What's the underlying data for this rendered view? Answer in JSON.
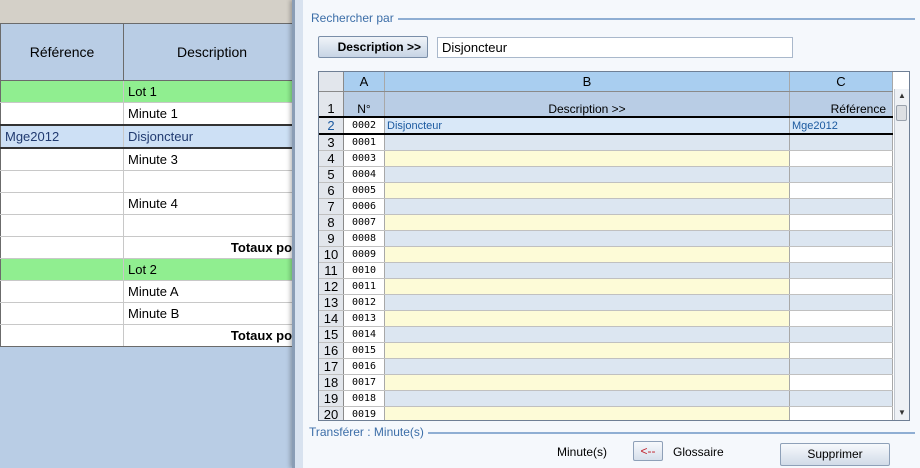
{
  "sheet": {
    "headers": {
      "reference": "Référence",
      "description": "Description"
    },
    "rows": [
      {
        "type": "green",
        "reference": "",
        "description": "Lot 1"
      },
      {
        "type": "normal",
        "reference": "",
        "description": "Minute 1"
      },
      {
        "type": "selected",
        "reference": "Mge2012",
        "description": "Disjoncteur"
      },
      {
        "type": "normal",
        "reference": "",
        "description": "Minute 3"
      },
      {
        "type": "normal",
        "reference": "",
        "description": ""
      },
      {
        "type": "normal",
        "reference": "",
        "description": "Minute 4"
      },
      {
        "type": "normal",
        "reference": "",
        "description": ""
      },
      {
        "type": "total",
        "reference": "",
        "description": "Totaux pou"
      },
      {
        "type": "green",
        "reference": "",
        "description": "Lot 2"
      },
      {
        "type": "normal",
        "reference": "",
        "description": "Minute A"
      },
      {
        "type": "normal",
        "reference": "",
        "description": "Minute B"
      },
      {
        "type": "total",
        "reference": "",
        "description": "Totaux pou"
      }
    ]
  },
  "dialog": {
    "search_group_label": "Rechercher par",
    "search_by_button": "Description >>",
    "search_value": "Disjoncteur",
    "grid": {
      "col_letters": [
        "A",
        "B",
        "C"
      ],
      "field_headers": [
        "N°",
        "Description >>",
        "Référence"
      ],
      "header_row_number": "1",
      "rows": [
        {
          "num": "2",
          "no": "0002",
          "description": "Disjoncteur",
          "reference": "Mge2012"
        },
        {
          "num": "3",
          "no": "0001",
          "description": "",
          "reference": ""
        },
        {
          "num": "4",
          "no": "0003",
          "description": "",
          "reference": ""
        },
        {
          "num": "5",
          "no": "0004",
          "description": "",
          "reference": ""
        },
        {
          "num": "6",
          "no": "0005",
          "description": "",
          "reference": ""
        },
        {
          "num": "7",
          "no": "0006",
          "description": "",
          "reference": ""
        },
        {
          "num": "8",
          "no": "0007",
          "description": "",
          "reference": ""
        },
        {
          "num": "9",
          "no": "0008",
          "description": "",
          "reference": ""
        },
        {
          "num": "10",
          "no": "0009",
          "description": "",
          "reference": ""
        },
        {
          "num": "11",
          "no": "0010",
          "description": "",
          "reference": ""
        },
        {
          "num": "12",
          "no": "0011",
          "description": "",
          "reference": ""
        },
        {
          "num": "13",
          "no": "0012",
          "description": "",
          "reference": ""
        },
        {
          "num": "14",
          "no": "0013",
          "description": "",
          "reference": ""
        },
        {
          "num": "15",
          "no": "0014",
          "description": "",
          "reference": ""
        },
        {
          "num": "16",
          "no": "0015",
          "description": "",
          "reference": ""
        },
        {
          "num": "17",
          "no": "0016",
          "description": "",
          "reference": ""
        },
        {
          "num": "18",
          "no": "0017",
          "description": "",
          "reference": ""
        },
        {
          "num": "19",
          "no": "0018",
          "description": "",
          "reference": ""
        },
        {
          "num": "20",
          "no": "0019",
          "description": "",
          "reference": ""
        }
      ]
    },
    "transfer_group_label": "Transférer : Minute(s)",
    "transfer_target_label": "Minute(s)",
    "transfer_arrow_button": "<--",
    "transfer_source_label": "Glossaire",
    "delete_button": "Supprimer"
  },
  "scrollbar_icons": {
    "up": "scroll-up-arrow-icon",
    "down": "scroll-down-arrow-icon"
  }
}
